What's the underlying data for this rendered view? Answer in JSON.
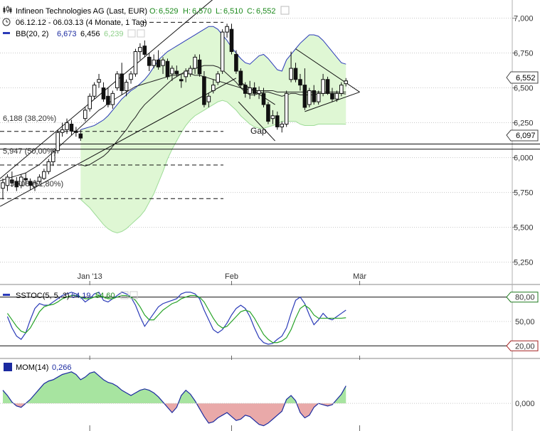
{
  "header": {
    "icon": "candlestick-icon",
    "title": "Infineon Technologies AG (Last, EUR)",
    "open_label": "O:",
    "open_value": "6,529",
    "high_label": "H:",
    "high_value": "6,570",
    "low_label": "L:",
    "low_value": "6,510",
    "close_label": "C:",
    "close_value": "6,552",
    "period_icon": "clock-icon",
    "period": "06.12.12 - 06.03.13 (4 Monate, 1 Tag)",
    "bb_label": "BB(20, 2)",
    "bb_upper": "6,673",
    "bb_middle": "6,456",
    "bb_lower": "6,239"
  },
  "colors": {
    "band_fill": "#dff7d4",
    "band_line": "#2b3bb8",
    "price_line": "#000000",
    "stoch_k": "#2b3bb8",
    "stoch_d": "#27a327",
    "mom_pos": "#a7e4a0",
    "mom_neg": "#e9a9a9",
    "grid": "#c8c8c8",
    "level_80": "#1f7a1f",
    "level_20": "#a32020"
  },
  "annotations": {
    "fib_382": "6,188 (38,20%)",
    "fib_500": "5,947 (50,00%)",
    "fib_618": "5,706 (61,80%)",
    "gap": "Gap",
    "last_price_tag": "6,552",
    "support_tag": "6,097"
  },
  "stoch": {
    "label": "SSTOC(5, 5, 3)",
    "k_value": "64,19",
    "d_value": "54,60"
  },
  "mom": {
    "label": "MOM(14)",
    "value": "0,266"
  },
  "chart_data": [
    {
      "type": "candlestick",
      "title": "Infineon Technologies AG (Last, EUR)",
      "y_tick_labels": [
        "7,000",
        "6,750",
        "6,500",
        "6,250",
        "6,000",
        "5,750",
        "5,500",
        "5,250"
      ],
      "y_ticks": [
        7.0,
        6.75,
        6.5,
        6.25,
        6.0,
        5.75,
        5.5,
        5.25
      ],
      "ylim": [
        5.09,
        7.13
      ],
      "x_tick_labels": [
        "Jan '13",
        "Feb",
        "Mär"
      ],
      "x_tick_index": [
        19,
        50,
        78
      ],
      "grid": "horizontal",
      "candles": [
        {
          "o": 5.78,
          "h": 5.85,
          "l": 5.7,
          "c": 5.82
        },
        {
          "o": 5.8,
          "h": 5.88,
          "l": 5.76,
          "c": 5.86
        },
        {
          "o": 5.84,
          "h": 5.9,
          "l": 5.79,
          "c": 5.82
        },
        {
          "o": 5.83,
          "h": 5.86,
          "l": 5.76,
          "c": 5.79
        },
        {
          "o": 5.8,
          "h": 5.88,
          "l": 5.78,
          "c": 5.86
        },
        {
          "o": 5.85,
          "h": 5.89,
          "l": 5.8,
          "c": 5.84
        },
        {
          "o": 5.83,
          "h": 5.85,
          "l": 5.77,
          "c": 5.8
        },
        {
          "o": 5.79,
          "h": 5.84,
          "l": 5.76,
          "c": 5.82
        },
        {
          "o": 5.83,
          "h": 5.88,
          "l": 5.81,
          "c": 5.86
        },
        {
          "o": 5.85,
          "h": 5.92,
          "l": 5.84,
          "c": 5.9
        },
        {
          "o": 5.9,
          "h": 5.99,
          "l": 5.88,
          "c": 5.97
        },
        {
          "o": 5.97,
          "h": 6.06,
          "l": 5.94,
          "c": 6.04
        },
        {
          "o": 6.05,
          "h": 6.2,
          "l": 6.03,
          "c": 6.18
        },
        {
          "o": 6.18,
          "h": 6.25,
          "l": 6.15,
          "c": 6.2
        },
        {
          "o": 6.2,
          "h": 6.28,
          "l": 6.17,
          "c": 6.25
        },
        {
          "o": 6.24,
          "h": 6.27,
          "l": 6.16,
          "c": 6.19
        },
        {
          "o": 6.19,
          "h": 6.22,
          "l": 6.15,
          "c": 6.18
        },
        {
          "o": 6.17,
          "h": 6.2,
          "l": 6.12,
          "c": 6.14
        },
        {
          "o": 6.28,
          "h": 6.36,
          "l": 6.26,
          "c": 6.34
        },
        {
          "o": 6.35,
          "h": 6.46,
          "l": 6.33,
          "c": 6.44
        },
        {
          "o": 6.44,
          "h": 6.54,
          "l": 6.42,
          "c": 6.52
        },
        {
          "o": 6.54,
          "h": 6.6,
          "l": 6.5,
          "c": 6.56
        },
        {
          "o": 6.5,
          "h": 6.54,
          "l": 6.4,
          "c": 6.42
        },
        {
          "o": 6.44,
          "h": 6.5,
          "l": 6.36,
          "c": 6.38
        },
        {
          "o": 6.38,
          "h": 6.48,
          "l": 6.35,
          "c": 6.46
        },
        {
          "o": 6.5,
          "h": 6.62,
          "l": 6.48,
          "c": 6.6
        },
        {
          "o": 6.6,
          "h": 6.68,
          "l": 6.45,
          "c": 6.48
        },
        {
          "o": 6.48,
          "h": 6.56,
          "l": 6.44,
          "c": 6.54
        },
        {
          "o": 6.56,
          "h": 6.62,
          "l": 6.53,
          "c": 6.6
        },
        {
          "o": 6.6,
          "h": 6.78,
          "l": 6.58,
          "c": 6.76
        },
        {
          "o": 6.76,
          "h": 6.82,
          "l": 6.7,
          "c": 6.79
        },
        {
          "o": 6.8,
          "h": 6.84,
          "l": 6.72,
          "c": 6.74
        },
        {
          "o": 6.72,
          "h": 6.75,
          "l": 6.62,
          "c": 6.66
        },
        {
          "o": 6.66,
          "h": 6.74,
          "l": 6.64,
          "c": 6.7
        },
        {
          "o": 6.7,
          "h": 6.77,
          "l": 6.63,
          "c": 6.65
        },
        {
          "o": 6.66,
          "h": 6.72,
          "l": 6.6,
          "c": 6.7
        },
        {
          "o": 6.69,
          "h": 6.71,
          "l": 6.56,
          "c": 6.58
        },
        {
          "o": 6.6,
          "h": 6.66,
          "l": 6.55,
          "c": 6.64
        },
        {
          "o": 6.62,
          "h": 6.66,
          "l": 6.58,
          "c": 6.6
        },
        {
          "o": 6.56,
          "h": 6.6,
          "l": 6.5,
          "c": 6.55
        },
        {
          "o": 6.58,
          "h": 6.64,
          "l": 6.54,
          "c": 6.62
        },
        {
          "o": 6.6,
          "h": 6.66,
          "l": 6.58,
          "c": 6.64
        },
        {
          "o": 6.64,
          "h": 6.74,
          "l": 6.6,
          "c": 6.72
        },
        {
          "o": 6.7,
          "h": 6.74,
          "l": 6.58,
          "c": 6.6
        },
        {
          "o": 6.58,
          "h": 6.62,
          "l": 6.36,
          "c": 6.38
        },
        {
          "o": 6.4,
          "h": 6.46,
          "l": 6.36,
          "c": 6.44
        },
        {
          "o": 6.48,
          "h": 6.56,
          "l": 6.46,
          "c": 6.52
        },
        {
          "o": 6.54,
          "h": 6.62,
          "l": 6.52,
          "c": 6.6
        },
        {
          "o": 6.62,
          "h": 6.92,
          "l": 6.6,
          "c": 6.9
        },
        {
          "o": 6.9,
          "h": 6.96,
          "l": 6.86,
          "c": 6.94
        },
        {
          "o": 6.92,
          "h": 6.96,
          "l": 6.74,
          "c": 6.76
        },
        {
          "o": 6.74,
          "h": 6.77,
          "l": 6.6,
          "c": 6.62
        },
        {
          "o": 6.62,
          "h": 6.64,
          "l": 6.5,
          "c": 6.52
        },
        {
          "o": 6.52,
          "h": 6.54,
          "l": 6.43,
          "c": 6.46
        },
        {
          "o": 6.46,
          "h": 6.55,
          "l": 6.42,
          "c": 6.5
        },
        {
          "o": 6.5,
          "h": 6.54,
          "l": 6.44,
          "c": 6.46
        },
        {
          "o": 6.46,
          "h": 6.51,
          "l": 6.42,
          "c": 6.48
        },
        {
          "o": 6.46,
          "h": 6.5,
          "l": 6.36,
          "c": 6.38
        },
        {
          "o": 6.38,
          "h": 6.4,
          "l": 6.24,
          "c": 6.26
        },
        {
          "o": 6.28,
          "h": 6.34,
          "l": 6.24,
          "c": 6.3
        },
        {
          "o": 6.3,
          "h": 6.33,
          "l": 6.2,
          "c": 6.22
        },
        {
          "o": 6.22,
          "h": 6.26,
          "l": 6.18,
          "c": 6.24
        },
        {
          "o": 6.24,
          "h": 6.48,
          "l": 6.22,
          "c": 6.46
        },
        {
          "o": 6.56,
          "h": 6.76,
          "l": 6.54,
          "c": 6.64
        },
        {
          "o": 6.64,
          "h": 6.68,
          "l": 6.54,
          "c": 6.56
        },
        {
          "o": 6.56,
          "h": 6.6,
          "l": 6.48,
          "c": 6.52
        },
        {
          "o": 6.52,
          "h": 6.64,
          "l": 6.34,
          "c": 6.36
        },
        {
          "o": 6.38,
          "h": 6.5,
          "l": 6.36,
          "c": 6.48
        },
        {
          "o": 6.48,
          "h": 6.52,
          "l": 6.38,
          "c": 6.4
        },
        {
          "o": 6.4,
          "h": 6.48,
          "l": 6.38,
          "c": 6.46
        },
        {
          "o": 6.46,
          "h": 6.6,
          "l": 6.44,
          "c": 6.56
        },
        {
          "o": 6.56,
          "h": 6.58,
          "l": 6.45,
          "c": 6.46
        },
        {
          "o": 6.46,
          "h": 6.5,
          "l": 6.4,
          "c": 6.42
        },
        {
          "o": 6.42,
          "h": 6.48,
          "l": 6.4,
          "c": 6.46
        },
        {
          "o": 6.46,
          "h": 6.54,
          "l": 6.44,
          "c": 6.52
        },
        {
          "o": 6.53,
          "h": 6.57,
          "l": 6.51,
          "c": 6.55
        }
      ],
      "bollinger": {
        "upper": [
          6.2,
          6.21,
          6.22,
          6.23,
          6.25,
          6.27,
          6.3,
          6.34,
          6.38,
          6.42,
          6.45,
          6.48,
          6.5,
          6.53,
          6.56,
          6.6,
          6.65,
          6.7,
          6.73,
          6.76,
          6.78,
          6.8,
          6.82,
          6.84,
          6.86,
          6.88,
          6.9,
          6.92,
          6.94,
          6.94,
          6.92,
          6.88,
          6.84,
          6.79,
          6.75,
          6.71,
          6.68,
          6.67,
          6.7,
          6.73,
          6.74,
          6.71,
          6.67,
          6.63,
          6.62,
          6.7,
          6.74,
          6.78,
          6.82,
          6.85,
          6.88,
          6.88,
          6.87,
          6.84,
          6.8,
          6.76,
          6.72,
          6.68,
          6.67
        ],
        "middle": [
          5.95,
          5.94,
          5.95,
          5.97,
          5.99,
          6.01,
          6.04,
          6.08,
          6.12,
          6.16,
          6.2,
          6.25,
          6.29,
          6.34,
          6.38,
          6.41,
          6.44,
          6.47,
          6.5,
          6.53,
          6.56,
          6.58,
          6.6,
          6.62,
          6.63,
          6.64,
          6.65,
          6.66,
          6.66,
          6.66,
          6.65,
          6.63,
          6.6,
          6.57,
          6.54,
          6.5,
          6.47,
          6.45,
          6.45,
          6.46,
          6.47,
          6.47,
          6.46,
          6.45,
          6.44,
          6.45,
          6.46,
          6.46,
          6.45,
          6.45,
          6.45,
          6.45,
          6.46,
          6.46,
          6.46,
          6.46,
          6.46,
          6.46,
          6.456
        ],
        "lower": [
          5.7,
          5.67,
          5.64,
          5.6,
          5.56,
          5.52,
          5.49,
          5.47,
          5.46,
          5.47,
          5.49,
          5.52,
          5.55,
          5.58,
          5.62,
          5.68,
          5.74,
          5.82,
          5.9,
          5.99,
          6.06,
          6.12,
          6.18,
          6.23,
          6.27,
          6.3,
          6.32,
          6.34,
          6.36,
          6.38,
          6.4,
          6.41,
          6.4,
          6.37,
          6.34,
          6.3,
          6.27,
          6.24,
          6.22,
          6.21,
          6.21,
          6.22,
          6.23,
          6.24,
          6.26,
          6.26,
          6.26,
          6.26,
          6.24,
          6.23,
          6.23,
          6.23,
          6.24,
          6.24,
          6.24,
          6.24,
          6.24,
          6.24,
          6.239
        ]
      },
      "moving_average": [
        5.83,
        5.84,
        5.85,
        5.86,
        5.87,
        5.88,
        5.89,
        5.91,
        5.93,
        5.95,
        5.98,
        6.01,
        6.04,
        6.07,
        6.1,
        6.13,
        6.16,
        6.19,
        6.22,
        6.25,
        6.28,
        6.31,
        6.34,
        6.36,
        6.39,
        6.41,
        6.43,
        6.45,
        6.47,
        6.49,
        6.51,
        6.52,
        6.53,
        6.54,
        6.55,
        6.56,
        6.57,
        6.58,
        6.59,
        6.59,
        6.6,
        6.6,
        6.6,
        6.59,
        6.59,
        6.58,
        6.57,
        6.56,
        6.55,
        6.54,
        6.53,
        6.52,
        6.51,
        6.5,
        6.49,
        6.49,
        6.48,
        6.48,
        6.48,
        6.48,
        6.48,
        6.47,
        6.47,
        6.47,
        6.47,
        6.47,
        6.47,
        6.47,
        6.47,
        6.47,
        6.47,
        6.47,
        6.47,
        6.47,
        6.47,
        6.47,
        6.47
      ],
      "horizontal_levels": [
        {
          "label": "6,188 (38,20%)",
          "value": 6.188,
          "style": "dashed"
        },
        {
          "label": "5,947 (50,00%)",
          "value": 5.947,
          "style": "dashed"
        },
        {
          "label": "5,706 (61,80%)",
          "value": 5.706,
          "style": "dashed"
        },
        {
          "value": 6.97,
          "style": "dashed"
        },
        {
          "label": "6,097",
          "value": 6.097,
          "style": "solid"
        },
        {
          "value": 6.06,
          "style": "solid"
        }
      ]
    },
    {
      "type": "line",
      "title": "SSTOC(5, 5, 3)",
      "y_tick_labels": [
        "80,00",
        "50,00",
        "20,00"
      ],
      "y_ticks": [
        80,
        50,
        20
      ],
      "ylim": [
        8,
        92
      ],
      "series": [
        {
          "name": "SSTOC(5, 5, 3)",
          "values": [
            56,
            42,
            32,
            28,
            36,
            52,
            66,
            72,
            70,
            70,
            74,
            78,
            82,
            84,
            86,
            84,
            80,
            74,
            78,
            84,
            86,
            76,
            74,
            78,
            82,
            86,
            84,
            80,
            70,
            56,
            44,
            52,
            60,
            68,
            72,
            74,
            76,
            78,
            84,
            86,
            86,
            84,
            78,
            64,
            52,
            40,
            36,
            40,
            48,
            58,
            66,
            70,
            66,
            56,
            42,
            30,
            24,
            22,
            23,
            28,
            32,
            42,
            60,
            76,
            80,
            72,
            58,
            46,
            52,
            60,
            54,
            52,
            56,
            60,
            64
          ]
        },
        {
          "name": "54,60",
          "values": [
            60,
            52,
            44,
            38,
            36,
            42,
            52,
            62,
            68,
            70,
            71,
            74,
            78,
            80,
            82,
            82,
            80,
            78,
            78,
            80,
            82,
            80,
            78,
            78,
            80,
            82,
            82,
            80,
            76,
            68,
            58,
            52,
            52,
            58,
            64,
            68,
            72,
            74,
            78,
            80,
            82,
            82,
            80,
            74,
            64,
            54,
            46,
            42,
            44,
            50,
            56,
            62,
            64,
            62,
            54,
            44,
            34,
            28,
            24,
            24,
            26,
            30,
            40,
            54,
            66,
            70,
            66,
            58,
            54,
            54,
            54,
            54,
            54,
            54,
            54.6
          ]
        }
      ]
    },
    {
      "type": "area",
      "title": "MOM(14)",
      "y_tick_labels": [
        "0,000"
      ],
      "y_ticks": [
        0
      ],
      "ylim": [
        -0.42,
        0.64
      ],
      "series": [
        {
          "name": "MOM(14)",
          "values": [
            0.2,
            0.12,
            0.02,
            -0.04,
            -0.06,
            0.0,
            0.06,
            0.14,
            0.22,
            0.3,
            0.34,
            0.36,
            0.4,
            0.44,
            0.46,
            0.48,
            0.44,
            0.36,
            0.4,
            0.46,
            0.48,
            0.42,
            0.36,
            0.32,
            0.3,
            0.26,
            0.2,
            0.16,
            0.12,
            0.16,
            0.2,
            0.22,
            0.2,
            0.16,
            0.1,
            0.02,
            -0.06,
            -0.14,
            -0.06,
            0.12,
            0.2,
            0.14,
            0.04,
            -0.08,
            -0.2,
            -0.3,
            -0.28,
            -0.22,
            -0.18,
            -0.14,
            -0.2,
            -0.26,
            -0.24,
            -0.18,
            -0.2,
            -0.26,
            -0.32,
            -0.34,
            -0.3,
            -0.24,
            -0.18,
            -0.12,
            0.06,
            0.12,
            0.04,
            -0.14,
            -0.22,
            -0.18,
            -0.06,
            0.0,
            -0.02,
            -0.04,
            -0.02,
            0.06,
            0.14,
            0.266
          ]
        }
      ]
    }
  ]
}
